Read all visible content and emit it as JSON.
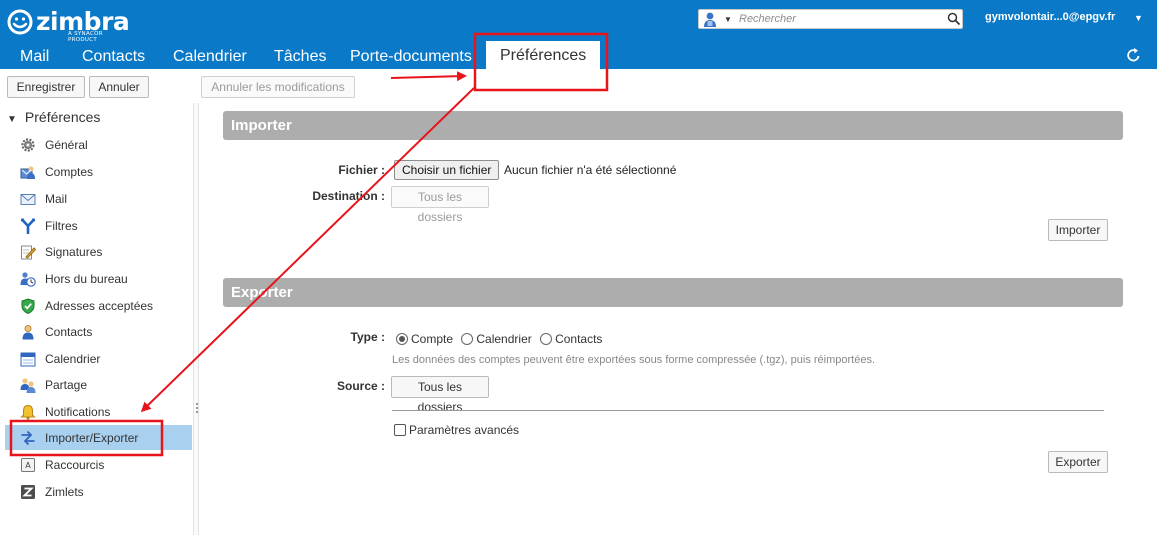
{
  "header": {
    "logo_text": "zimbra",
    "logo_subtext": "A SYNACOR PRODUCT",
    "search_placeholder": "Rechercher",
    "user": "gymvolontair...0@epgv.fr"
  },
  "tabs": [
    {
      "label": "Mail"
    },
    {
      "label": "Contacts"
    },
    {
      "label": "Calendrier"
    },
    {
      "label": "Tâches"
    },
    {
      "label": "Porte-documents"
    },
    {
      "label": "Préférences",
      "active": true
    }
  ],
  "toolbar": {
    "save": "Enregistrer",
    "cancel": "Annuler",
    "undo": "Annuler les modifications"
  },
  "sidebar": {
    "heading": "Préférences",
    "items": [
      {
        "label": "Général",
        "icon": "gear-icon"
      },
      {
        "label": "Comptes",
        "icon": "accounts-icon"
      },
      {
        "label": "Mail",
        "icon": "envelope-icon"
      },
      {
        "label": "Filtres",
        "icon": "filter-icon"
      },
      {
        "label": "Signatures",
        "icon": "signature-icon"
      },
      {
        "label": "Hors du bureau",
        "icon": "out-of-office-icon"
      },
      {
        "label": "Adresses acceptées",
        "icon": "shield-check-icon"
      },
      {
        "label": "Contacts",
        "icon": "contact-person-icon"
      },
      {
        "label": "Calendrier",
        "icon": "calendar-icon"
      },
      {
        "label": "Partage",
        "icon": "sharing-icon"
      },
      {
        "label": "Notifications",
        "icon": "bell-icon"
      },
      {
        "label": "Importer/Exporter",
        "icon": "import-export-icon",
        "selected": true
      },
      {
        "label": "Raccourcis",
        "icon": "keyboard-shortcut-icon"
      },
      {
        "label": "Zimlets",
        "icon": "zimlet-icon"
      }
    ]
  },
  "import": {
    "title": "Importer",
    "file_label": "Fichier :",
    "choose_file": "Choisir un fichier",
    "no_file": "Aucun fichier n'a été sélectionné",
    "destination_label": "Destination :",
    "destination_value": "Tous les dossiers",
    "import_button": "Importer"
  },
  "export": {
    "title": "Exporter",
    "type_label": "Type :",
    "types": [
      {
        "label": "Compte",
        "checked": true
      },
      {
        "label": "Calendrier",
        "checked": false
      },
      {
        "label": "Contacts",
        "checked": false
      }
    ],
    "hint": "Les données des comptes peuvent être exportées sous forme compressée (.tgz), puis réimportées.",
    "source_label": "Source :",
    "source_value": "Tous les dossiers",
    "advanced": "Paramètres avancés",
    "export_button": "Exporter"
  },
  "colors": {
    "header_blue": "#0a79c7",
    "selected_row": "#a9d1ef",
    "section_gray": "#adadad",
    "annotation_red": "#e8141c"
  }
}
